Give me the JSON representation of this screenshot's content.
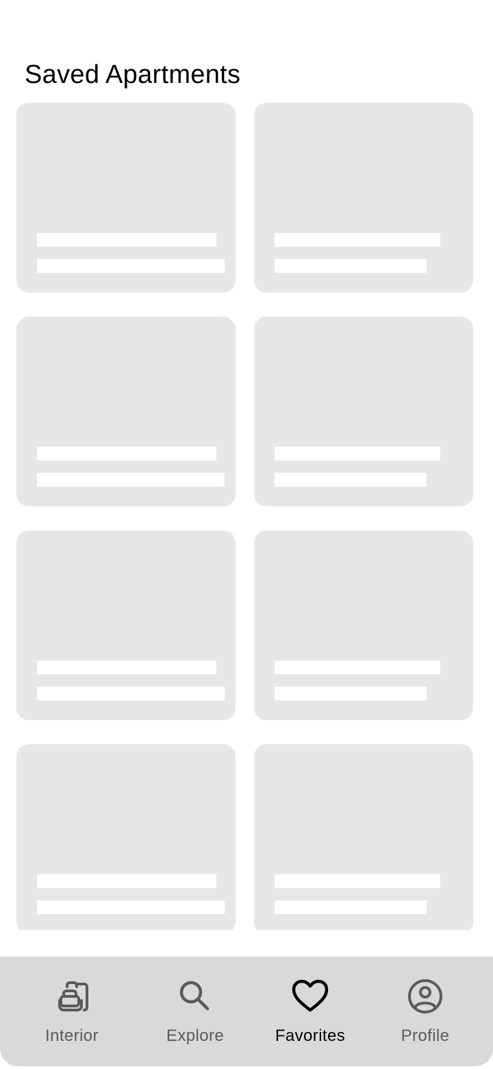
{
  "page": {
    "title": "Saved Apartments"
  },
  "cards": [
    {
      "id": 1
    },
    {
      "id": 2
    },
    {
      "id": 3
    },
    {
      "id": 4
    },
    {
      "id": 5
    },
    {
      "id": 6
    },
    {
      "id": 7
    },
    {
      "id": 8
    }
  ],
  "bottom_nav": {
    "items": [
      {
        "label": "Interior",
        "icon": "armchair-icon",
        "active": false
      },
      {
        "label": "Explore",
        "icon": "search-icon",
        "active": false
      },
      {
        "label": "Favorites",
        "icon": "heart-icon",
        "active": true
      },
      {
        "label": "Profile",
        "icon": "user-circle-icon",
        "active": false
      }
    ]
  },
  "colors": {
    "background": "#ffffff",
    "placeholder": "#e7e7e7",
    "nav_background": "#d9d9d9",
    "nav_inactive": "#5a5a5a",
    "nav_active": "#000000"
  }
}
